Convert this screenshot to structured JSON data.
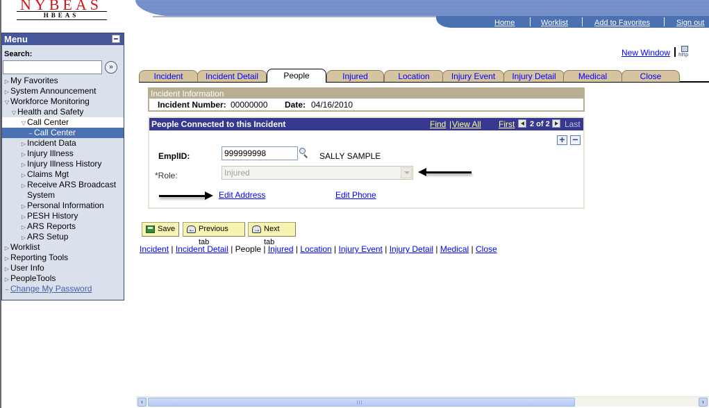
{
  "logo": {
    "main": "NYBEAS",
    "sub": "HBEAS"
  },
  "header_nav": [
    {
      "label": "Home"
    },
    {
      "label": "Worklist"
    },
    {
      "label": "Add to Favorites"
    },
    {
      "label": "Sign out"
    }
  ],
  "menu": {
    "title": "Menu",
    "search_label": "Search:",
    "search_value": "",
    "items": [
      {
        "label": "My Favorites",
        "level": 0,
        "state": "collapsed"
      },
      {
        "label": "System Announcement",
        "level": 0,
        "state": "collapsed"
      },
      {
        "label": "Workforce Monitoring",
        "level": 0,
        "state": "expanded"
      },
      {
        "label": "Health and Safety",
        "level": 1,
        "state": "expanded"
      },
      {
        "label": "Call Center",
        "level": 2,
        "state": "expanded"
      },
      {
        "label": "Call Center",
        "level": 3,
        "state": "selected"
      },
      {
        "label": "Incident Data",
        "level": 2,
        "state": "collapsed"
      },
      {
        "label": "Injury Illness",
        "level": 2,
        "state": "collapsed"
      },
      {
        "label": "Injury Illness History",
        "level": 2,
        "state": "collapsed"
      },
      {
        "label": "Claims Mgt",
        "level": 2,
        "state": "collapsed"
      },
      {
        "label": "Receive ARS Broadcast System",
        "level": 2,
        "state": "collapsed"
      },
      {
        "label": "Personal Information",
        "level": 2,
        "state": "collapsed"
      },
      {
        "label": "PESH History",
        "level": 2,
        "state": "collapsed"
      },
      {
        "label": "ARS Reports",
        "level": 2,
        "state": "collapsed"
      },
      {
        "label": "ARS Setup",
        "level": 2,
        "state": "collapsed"
      },
      {
        "label": "Worklist",
        "level": 0,
        "state": "collapsed"
      },
      {
        "label": "Reporting Tools",
        "level": 0,
        "state": "collapsed"
      },
      {
        "label": "User Info",
        "level": 0,
        "state": "collapsed"
      },
      {
        "label": "PeopleTools",
        "level": 0,
        "state": "collapsed"
      },
      {
        "label": "Change My Password",
        "level": 0,
        "state": "link"
      }
    ]
  },
  "new_window": "New Window",
  "http_icon_text": "http",
  "tabs": [
    {
      "label": "Incident",
      "active": false
    },
    {
      "label": "Incident Detail",
      "active": false
    },
    {
      "label": "People",
      "active": true
    },
    {
      "label": "Injured",
      "active": false
    },
    {
      "label": "Location",
      "active": false
    },
    {
      "label": "Injury Event",
      "active": false
    },
    {
      "label": "Injury Detail",
      "active": false
    },
    {
      "label": "Medical",
      "active": false
    },
    {
      "label": "Close",
      "active": false
    }
  ],
  "incident_info": {
    "title": "Incident Information",
    "number_label": "Incident Number:",
    "number_value": "00000000",
    "date_label": "Date:",
    "date_value": "04/16/2010"
  },
  "people": {
    "title": "People Connected to this Incident",
    "find": "Find",
    "view_all": "View All",
    "first": "First",
    "count": "2 of 2",
    "last": "Last",
    "emplid_label": "EmplID:",
    "emplid_value": "999999998",
    "employee_name": "SALLY SAMPLE",
    "role_label": "*Role:",
    "role_value": "Injured",
    "edit_address": "Edit Address",
    "edit_phone": "Edit Phone"
  },
  "buttons": {
    "save": "Save",
    "previous_tab": "Previous tab",
    "next_tab": "Next tab"
  },
  "bottom_links": [
    {
      "label": "Incident",
      "current": false
    },
    {
      "label": "Incident Detail",
      "current": false
    },
    {
      "label": "People",
      "current": true
    },
    {
      "label": "Injured",
      "current": false
    },
    {
      "label": "Location",
      "current": false
    },
    {
      "label": "Injury Event",
      "current": false
    },
    {
      "label": "Injury Detail",
      "current": false
    },
    {
      "label": "Medical",
      "current": false
    },
    {
      "label": "Close",
      "current": false
    }
  ],
  "colors": {
    "menu_header": "#46579b",
    "menu_bg": "#dbe1ec",
    "selected_item": "#4b71b3",
    "tab_bg": "#d6c4a0",
    "incident_header": "#b8ae92",
    "people_header": "#36398f",
    "button_bg": "#f7f3b0",
    "link": "#0000ff"
  }
}
